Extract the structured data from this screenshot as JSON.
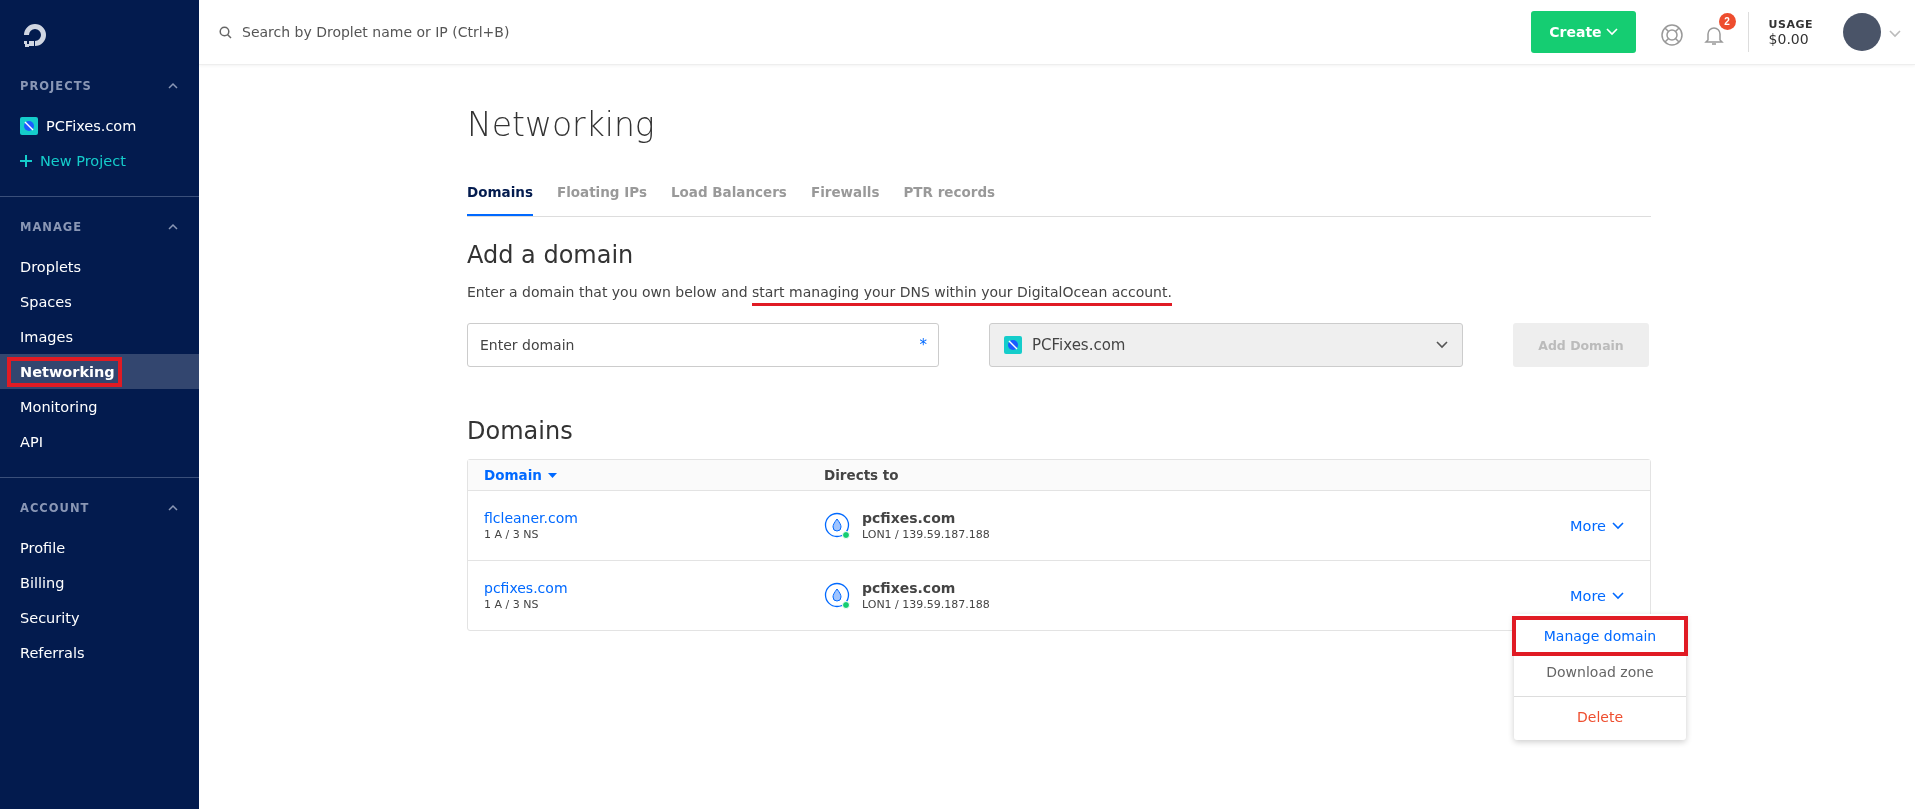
{
  "sidebar": {
    "sections": [
      {
        "title": "PROJECTS",
        "expanded": true,
        "items": [
          {
            "label": "PCFixes.com",
            "kind": "project",
            "selected": false,
            "highlighted": false
          },
          {
            "label": "New Project",
            "kind": "add",
            "selected": false,
            "highlighted": false
          }
        ]
      },
      {
        "title": "MANAGE",
        "expanded": true,
        "items": [
          {
            "label": "Droplets",
            "kind": "link",
            "selected": false,
            "highlighted": false
          },
          {
            "label": "Spaces",
            "kind": "link",
            "selected": false,
            "highlighted": false
          },
          {
            "label": "Images",
            "kind": "link",
            "selected": false,
            "highlighted": false
          },
          {
            "label": "Networking",
            "kind": "link",
            "selected": true,
            "highlighted": true
          },
          {
            "label": "Monitoring",
            "kind": "link",
            "selected": false,
            "highlighted": false
          },
          {
            "label": "API",
            "kind": "link",
            "selected": false,
            "highlighted": false
          }
        ]
      },
      {
        "title": "ACCOUNT",
        "expanded": true,
        "items": [
          {
            "label": "Profile",
            "kind": "link",
            "selected": false,
            "highlighted": false
          },
          {
            "label": "Billing",
            "kind": "link",
            "selected": false,
            "highlighted": false
          },
          {
            "label": "Security",
            "kind": "link",
            "selected": false,
            "highlighted": false
          },
          {
            "label": "Referrals",
            "kind": "link",
            "selected": false,
            "highlighted": false
          }
        ]
      }
    ]
  },
  "topbar": {
    "search": {
      "placeholder": "Search by Droplet name or IP (Ctrl+B)"
    },
    "create_button": "Create",
    "notifications": "2",
    "usage_label": "USAGE",
    "usage_value": "$0.00"
  },
  "page": {
    "title": "Networking",
    "tabs": [
      {
        "label": "Domains",
        "selected": true
      },
      {
        "label": "Floating IPs",
        "selected": false
      },
      {
        "label": "Load Balancers",
        "selected": false
      },
      {
        "label": "Firewalls",
        "selected": false
      },
      {
        "label": "PTR records",
        "selected": false
      }
    ],
    "add_domain": {
      "heading": "Add a domain",
      "description": "Enter a domain that you own below and ",
      "description_underlined": "start managing your DNS within your DigitalOcean account.",
      "domain_field": {
        "placeholder": "Enter domain",
        "required_mark": "*"
      },
      "project_select": {
        "value": "PCFixes.com"
      },
      "add_button": {
        "label": "Add Domain",
        "disabled": true
      }
    },
    "domains": {
      "heading": "Domains",
      "columns": [
        {
          "label": "Domain",
          "sorted": true
        },
        {
          "label": "Directs to",
          "sorted": false
        }
      ],
      "rows": [
        {
          "domain": "flcleaner.com",
          "records": "1 A / 3 NS",
          "target": "pcfixes.com",
          "target_detail": "LON1 / 139.59.187.188",
          "more": "More",
          "menu_open": false
        },
        {
          "domain": "pcfixes.com",
          "records": "1 A / 3 NS",
          "target": "pcfixes.com",
          "target_detail": "LON1 / 139.59.187.188",
          "more": "More",
          "menu_open": true
        }
      ],
      "menu": [
        {
          "label": "Manage domain",
          "kind": "primary",
          "highlighted": true
        },
        {
          "label": "Download zone",
          "kind": "normal",
          "highlighted": false
        },
        {
          "label": "Delete",
          "kind": "danger",
          "highlighted": false
        }
      ]
    }
  }
}
